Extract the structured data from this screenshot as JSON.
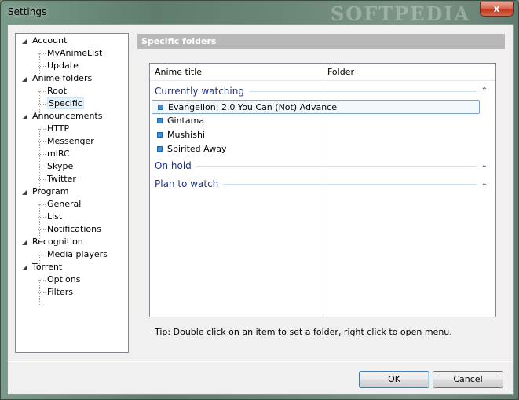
{
  "window": {
    "title": "Settings",
    "watermark": "SOFTPEDIA",
    "close_glyph": "x"
  },
  "tree": {
    "items": [
      {
        "label": "Account",
        "level": 0
      },
      {
        "label": "MyAnimeList",
        "level": 1
      },
      {
        "label": "Update",
        "level": 1
      },
      {
        "label": "Anime folders",
        "level": 0
      },
      {
        "label": "Root",
        "level": 1
      },
      {
        "label": "Specific",
        "level": 1,
        "selected": true
      },
      {
        "label": "Announcements",
        "level": 0
      },
      {
        "label": "HTTP",
        "level": 1
      },
      {
        "label": "Messenger",
        "level": 1
      },
      {
        "label": "mIRC",
        "level": 1
      },
      {
        "label": "Skype",
        "level": 1
      },
      {
        "label": "Twitter",
        "level": 1
      },
      {
        "label": "Program",
        "level": 0
      },
      {
        "label": "General",
        "level": 1
      },
      {
        "label": "List",
        "level": 1
      },
      {
        "label": "Notifications",
        "level": 1
      },
      {
        "label": "Recognition",
        "level": 0
      },
      {
        "label": "Media players",
        "level": 1
      },
      {
        "label": "Torrent",
        "level": 0
      },
      {
        "label": "Options",
        "level": 1
      },
      {
        "label": "Filters",
        "level": 1
      }
    ],
    "expand_glyph": "◢"
  },
  "page": {
    "header": "Specific folders",
    "columns": [
      "Anime title",
      "Folder"
    ],
    "groups": [
      {
        "label": "Currently watching",
        "expanded": true,
        "chevron": "⌃",
        "rows": [
          {
            "title": "Evangelion: 2.0 You Can (Not) Advance",
            "folder": "",
            "selected": true
          },
          {
            "title": "Gintama",
            "folder": ""
          },
          {
            "title": "Mushishi",
            "folder": ""
          },
          {
            "title": "Spirited Away",
            "folder": ""
          }
        ]
      },
      {
        "label": "On hold",
        "expanded": false,
        "chevron": "⌄",
        "rows": []
      },
      {
        "label": "Plan to watch",
        "expanded": false,
        "chevron": "⌄",
        "rows": []
      }
    ],
    "tip": "Tip: Double click on an item to set a folder, right click to open menu."
  },
  "buttons": {
    "ok": "OK",
    "cancel": "Cancel"
  },
  "colors": {
    "group_text": "#1e3287",
    "header_bg": "#b8b8b8",
    "selection_border": "#7da2ce"
  }
}
